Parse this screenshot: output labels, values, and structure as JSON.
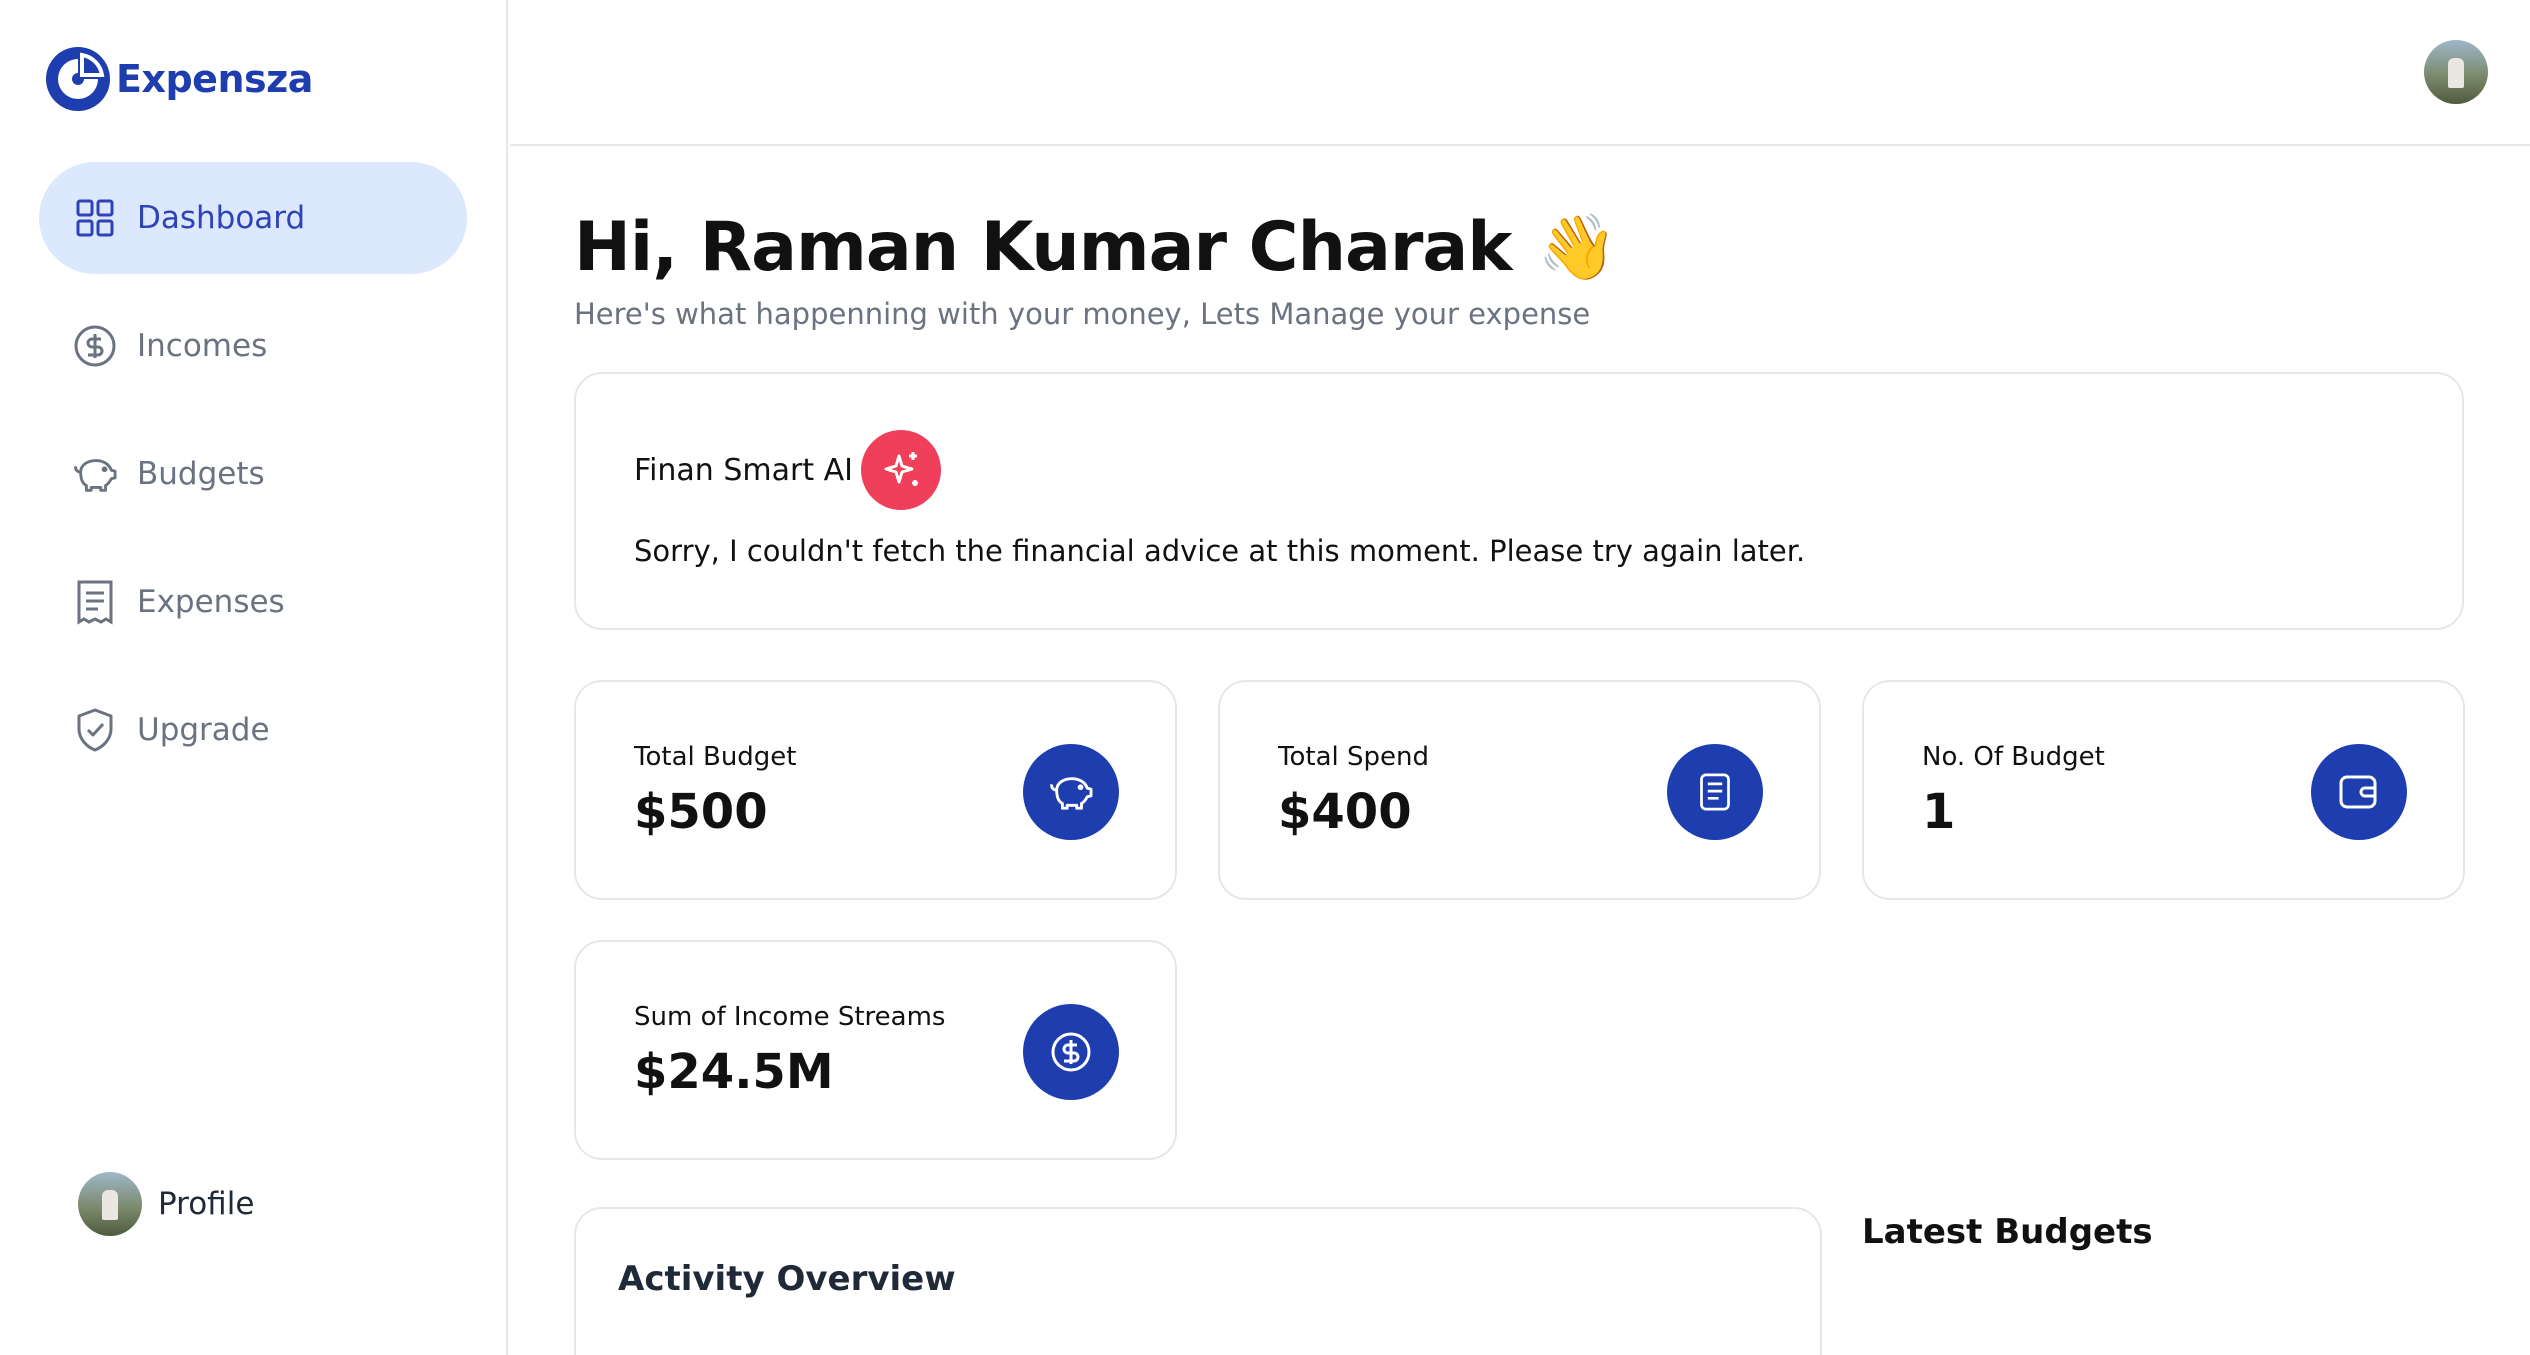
{
  "app": {
    "name": "Expensza"
  },
  "sidebar": {
    "items": [
      {
        "label": "Dashboard",
        "icon": "grid-icon",
        "active": true
      },
      {
        "label": "Incomes",
        "icon": "dollar-circle-icon",
        "active": false
      },
      {
        "label": "Budgets",
        "icon": "piggy-bank-icon",
        "active": false
      },
      {
        "label": "Expenses",
        "icon": "receipt-icon",
        "active": false
      },
      {
        "label": "Upgrade",
        "icon": "shield-check-icon",
        "active": false
      }
    ],
    "profile_label": "Profile"
  },
  "header": {
    "greeting": "Hi, Raman Kumar Charak",
    "wave": "👋",
    "subtitle": "Here's what happenning with your money, Lets Manage your expense"
  },
  "ai": {
    "title": "Finan Smart AI",
    "message": "Sorry, I couldn't fetch the financial advice at this moment. Please try again later."
  },
  "stats": [
    {
      "label": "Total Budget",
      "value": "$500",
      "icon": "piggy-bank-icon"
    },
    {
      "label": "Total Spend",
      "value": "$400",
      "icon": "receipt-icon"
    },
    {
      "label": "No. Of Budget",
      "value": "1",
      "icon": "wallet-icon"
    },
    {
      "label": "Sum of Income Streams",
      "value": "$24.5M",
      "icon": "dollar-circle-icon"
    }
  ],
  "sections": {
    "activity_title": "Activity Overview",
    "latest_title": "Latest Budgets"
  },
  "colors": {
    "brand": "#1e3eb0",
    "active_bg": "#dbe8fd",
    "active_text": "#2f42b8",
    "ai_badge": "#ef3f5a",
    "muted_text": "#6b7280"
  }
}
